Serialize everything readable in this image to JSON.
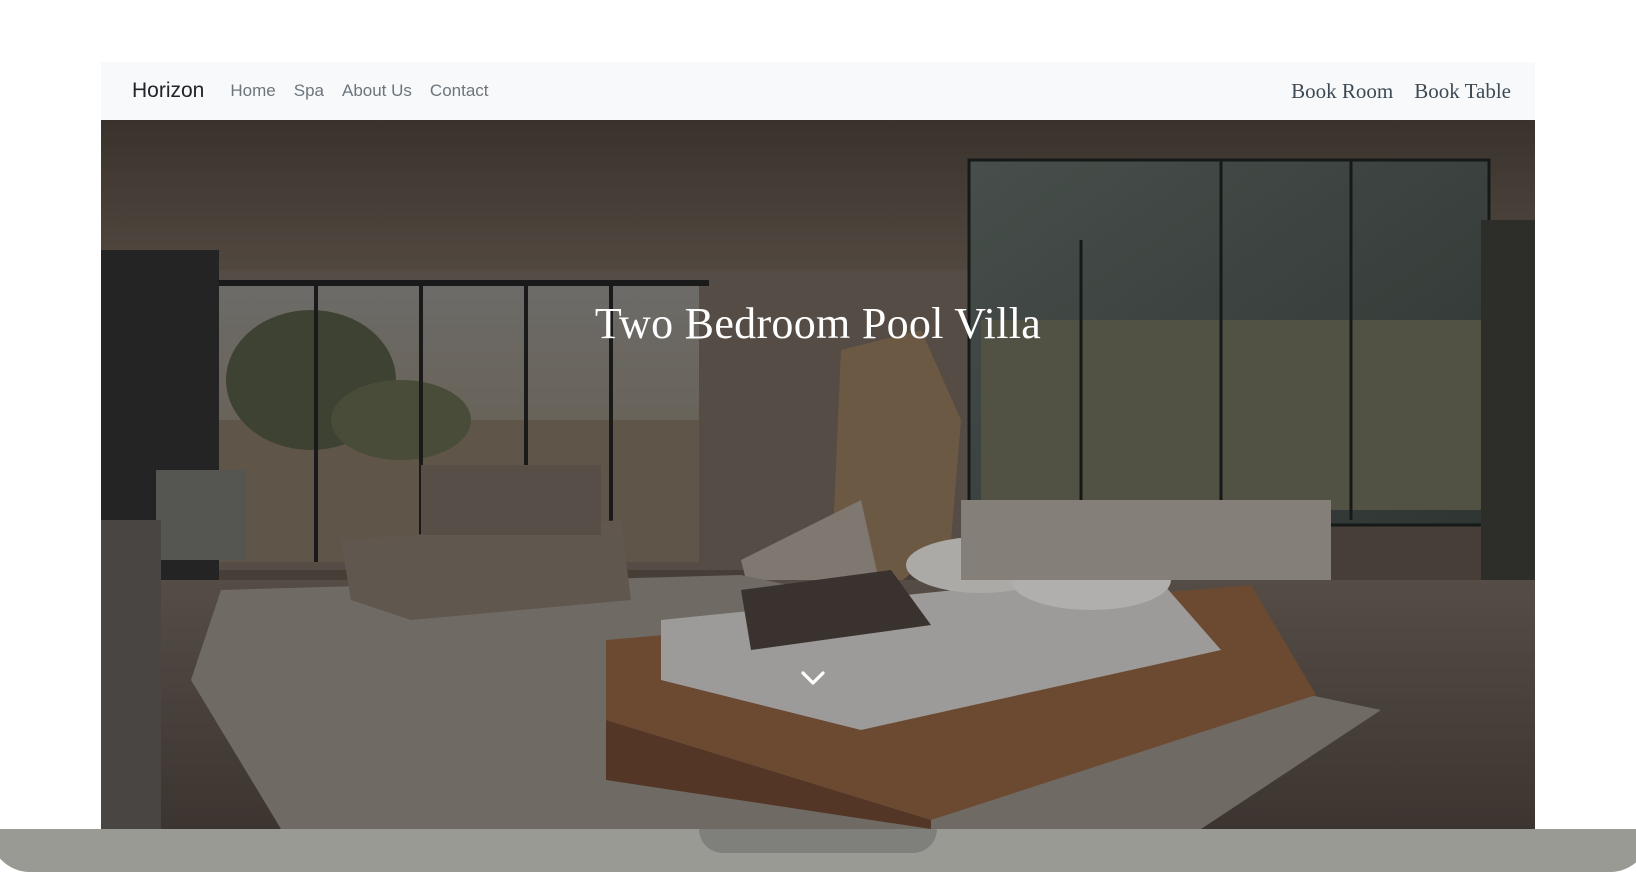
{
  "navbar": {
    "brand": "Horizon",
    "links": [
      {
        "label": "Home"
      },
      {
        "label": "Spa"
      },
      {
        "label": "About Us"
      },
      {
        "label": "Contact"
      }
    ],
    "actions": [
      {
        "label": "Book Room"
      },
      {
        "label": "Book Table"
      }
    ]
  },
  "hero": {
    "title": "Two Bedroom Pool Villa",
    "scroll_icon": "chevron-down-icon"
  },
  "colors": {
    "navbar_bg": "#f8f9fa",
    "brand_text": "#212529",
    "nav_link_text": "#6c757d",
    "action_text": "#3d4a55",
    "hero_title": "#ffffff"
  }
}
